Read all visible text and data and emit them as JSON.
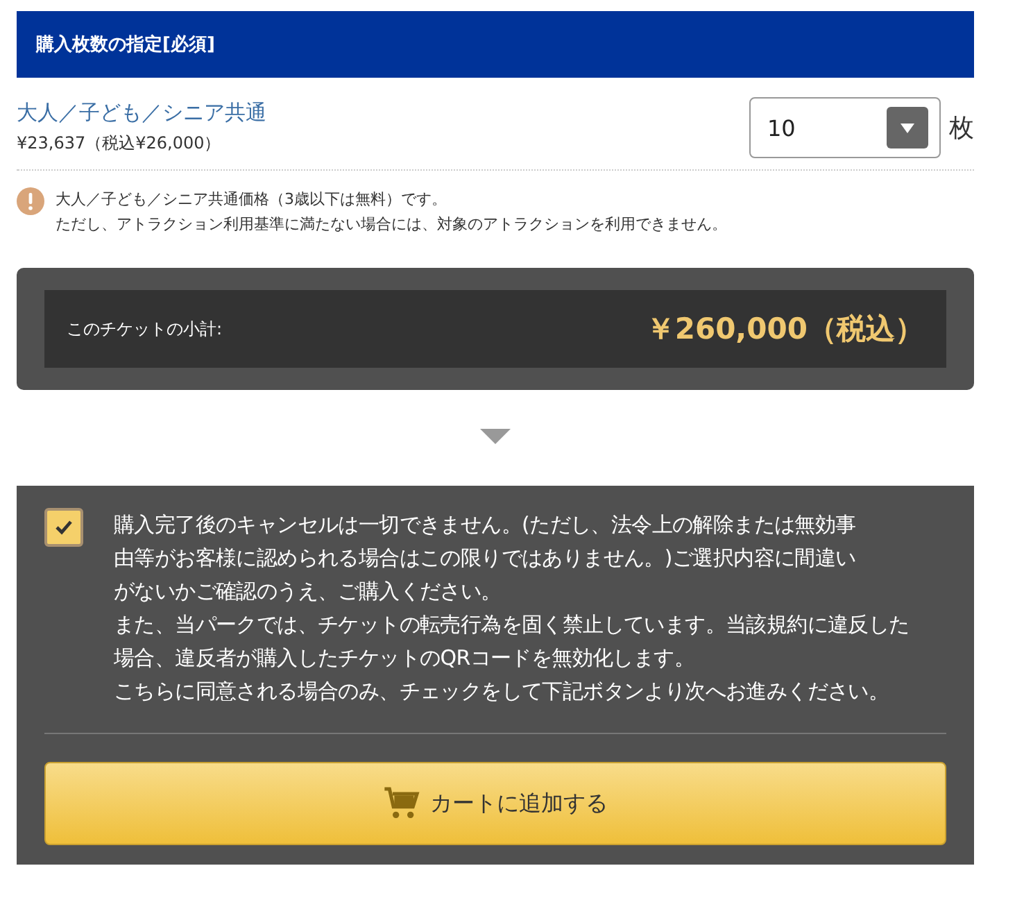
{
  "header": {
    "title": "購入枚数の指定[必須]"
  },
  "ticket": {
    "name": "大人／子ども／シニア共通",
    "price": "¥23,637（税込¥26,000）",
    "quantity": "10",
    "unit": "枚"
  },
  "notice": {
    "lines": [
      "大人／子ども／シニア共通価格（3歳以下は無料）です。",
      "ただし、アトラクション利用基準に満たない場合には、対象のアトラクションを利用できません。"
    ]
  },
  "subtotal": {
    "label": "このチケットの小計:",
    "amount": "￥260,000（税込）"
  },
  "terms": {
    "checked": true,
    "lines": [
      "購入完了後のキャンセルは一切できません。(ただし、法令上の解除または無効事",
      "由等がお客様に認められる場合はこの限りではありません。)ご選択内容に間違い",
      "がないかご確認のうえ、ご購入ください。",
      "また、当パークでは、チケットの転売行為を固く禁止しています。当該規約に違反した",
      "場合、違反者が購入したチケットのQRコードを無効化します。",
      "こちらに同意される場合のみ、チェックをして下記ボタンより次へお進みください。"
    ]
  },
  "button": {
    "label": "カートに追加する"
  }
}
